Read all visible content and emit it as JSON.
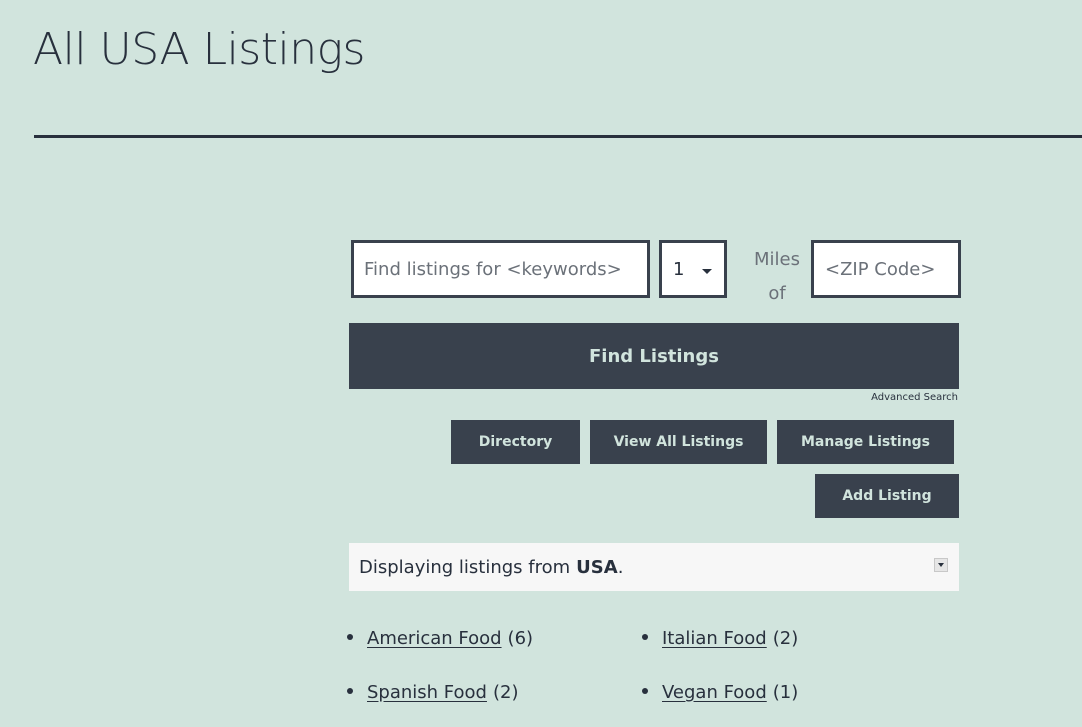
{
  "page": {
    "title": "All USA Listings"
  },
  "search": {
    "keywords_placeholder": "Find listings for <keywords>",
    "radius_value": "1",
    "miles_label_line1": "Miles",
    "miles_label_line2": "of",
    "zip_placeholder": "<ZIP Code>",
    "find_button": "Find Listings",
    "advanced_link": "Advanced Search"
  },
  "actions": {
    "directory": "Directory",
    "view_all": "View All Listings",
    "manage": "Manage Listings",
    "add": "Add Listing"
  },
  "display_bar": {
    "prefix": "Displaying listings from",
    "region": "USA",
    "suffix": "."
  },
  "categories": [
    {
      "name": "American Food",
      "count": "(6)"
    },
    {
      "name": "Italian Food",
      "count": "(2)"
    },
    {
      "name": "Spanish Food",
      "count": "(2)"
    },
    {
      "name": "Vegan Food",
      "count": "(1)"
    }
  ],
  "colors": {
    "background": "#d1e4dd",
    "button": "#39414d",
    "text": "#28303d"
  }
}
